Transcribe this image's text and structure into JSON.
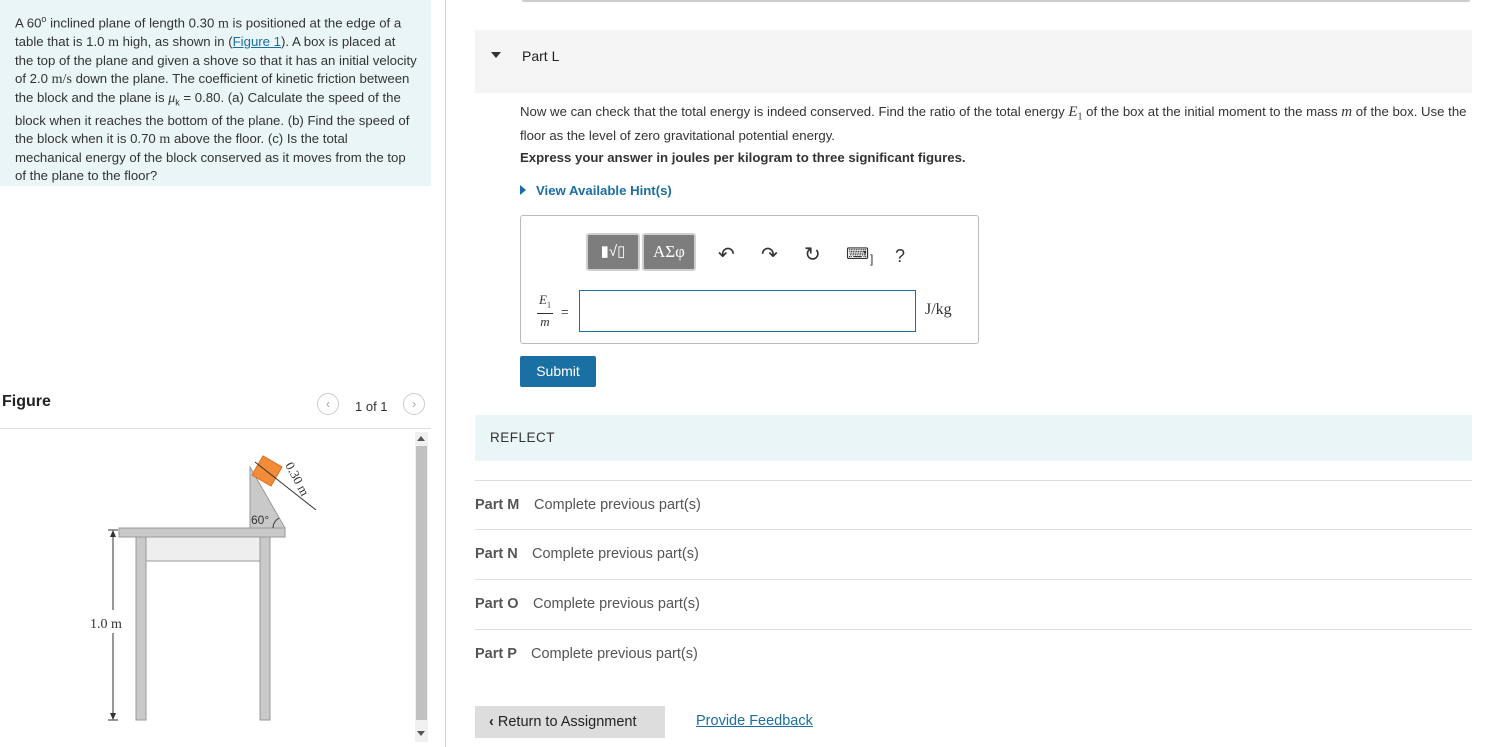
{
  "problem": {
    "t1": "A 60",
    "t1_sup": "o",
    "t2": " inclined plane of length 0.30 ",
    "m1": "m",
    "t3": " is positioned at the edge of a table that is 1.0 ",
    "m2": "m",
    "t4": " high, as shown in (",
    "figure_link": "Figure 1",
    "t5": "). A box is placed at the top of the plane and given a shove so that it has an initial velocity of 2.0 ",
    "m3": "m/s",
    "t6": " down the plane. The coefficient of kinetic friction between the block and the plane is ",
    "mu": "μ",
    "mu_sub": "k",
    "t7": " = 0.80. (a) Calculate the speed of the block when it reaches the bottom of the plane. (b) Find the speed of the block when it is 0.70 ",
    "m4": "m",
    "t8": " above the floor. (c) Is the total mechanical energy of the block conserved as it moves from the top of the plane to the floor?"
  },
  "figure": {
    "title": "Figure",
    "pager": "1 of 1",
    "prev_icon": "chevron-left-icon",
    "next_icon": "chevron-right-icon",
    "label_length": "0.30 m",
    "label_angle": "60°",
    "label_height": "1.0 m",
    "box_color": "#f28c38"
  },
  "part": {
    "label": "Part L",
    "q1": "Now we can check that the total energy is indeed conserved. Find the ratio of the total energy ",
    "E": "E",
    "E_sub": "1",
    "q2": " of the box at the initial moment to the mass ",
    "m": "m",
    "q3": " of the box. Use the floor as the level of zero gravitational potential energy.",
    "instruction": "Express your answer in joules per kilogram to three significant figures.",
    "hint": "View Available Hint(s)",
    "frac_num": "E",
    "frac_num_sub": "1",
    "frac_den": "m",
    "equals": "=",
    "answer_value": "",
    "unit": "J/kg",
    "submit": "Submit",
    "toolbar": {
      "templates_btn": "▮√▯",
      "greek_btn": "ΑΣφ",
      "undo_icon": "undo-icon",
      "redo_icon": "redo-icon",
      "reset_icon": "reset-icon",
      "keyboard_icon": "keyboard-icon",
      "help": "?"
    }
  },
  "reflect": "REFLECT",
  "parts": [
    {
      "label": "Part M",
      "status": "Complete previous part(s)"
    },
    {
      "label": "Part N",
      "status": "Complete previous part(s)"
    },
    {
      "label": "Part O",
      "status": "Complete previous part(s)"
    },
    {
      "label": "Part P",
      "status": "Complete previous part(s)"
    }
  ],
  "nav": {
    "return_label": "Return to Assignment",
    "feedback": "Provide Feedback"
  },
  "colors": {
    "accent": "#1a6fa3",
    "panel_bg": "#eaf5f7"
  }
}
